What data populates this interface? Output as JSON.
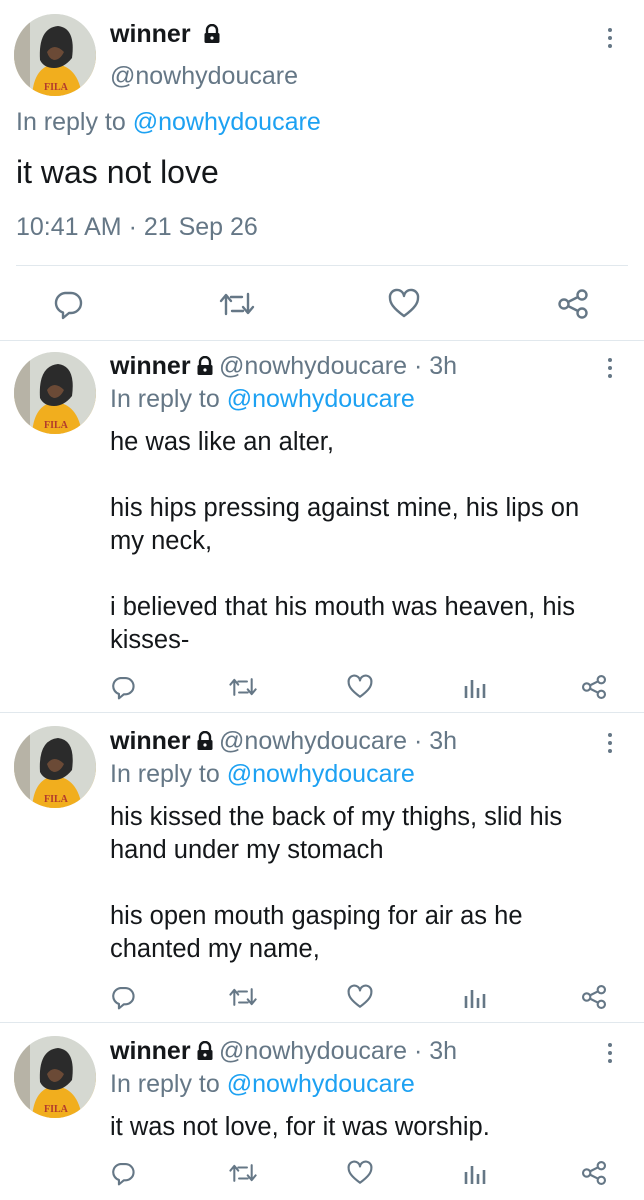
{
  "main_tweet": {
    "author_name": "winner",
    "author_handle": "@nowhydoucare",
    "reply_to_prefix": "In reply to ",
    "reply_to_handle": "@nowhydoucare",
    "text": "it was not love",
    "timestamp": "10:41 AM · 21 Sep 26"
  },
  "replies": [
    {
      "author_name": "winner",
      "meta": "@nowhydoucare · 3h",
      "reply_to_prefix": "In reply to ",
      "reply_to_handle": "@nowhydoucare",
      "text": "he was like an alter,\n\nhis hips pressing against mine, his lips on\nmy neck,\n\ni believed that his mouth was heaven, his\nkisses-"
    },
    {
      "author_name": "winner",
      "meta": "@nowhydoucare · 3h",
      "reply_to_prefix": "In reply to ",
      "reply_to_handle": "@nowhydoucare",
      "text": "his kissed the back of my thighs, slid his\nhand under my stomach\n\nhis open mouth gasping for air as he\nchanted my name,"
    },
    {
      "author_name": "winner",
      "meta": "@nowhydoucare · 3h",
      "reply_to_prefix": "In reply to ",
      "reply_to_handle": "@nowhydoucare",
      "text": "it was not love, for it was worship."
    }
  ],
  "icons": {
    "reply": "reply-icon",
    "retweet": "retweet-icon",
    "like": "heart-icon",
    "analytics": "analytics-icon",
    "share": "share-icon",
    "more": "more-vertical-icon",
    "lock": "lock-icon"
  },
  "colors": {
    "link": "#1da1f2",
    "secondary": "#657786",
    "text": "#14171a",
    "divider": "#e1e8ed"
  }
}
